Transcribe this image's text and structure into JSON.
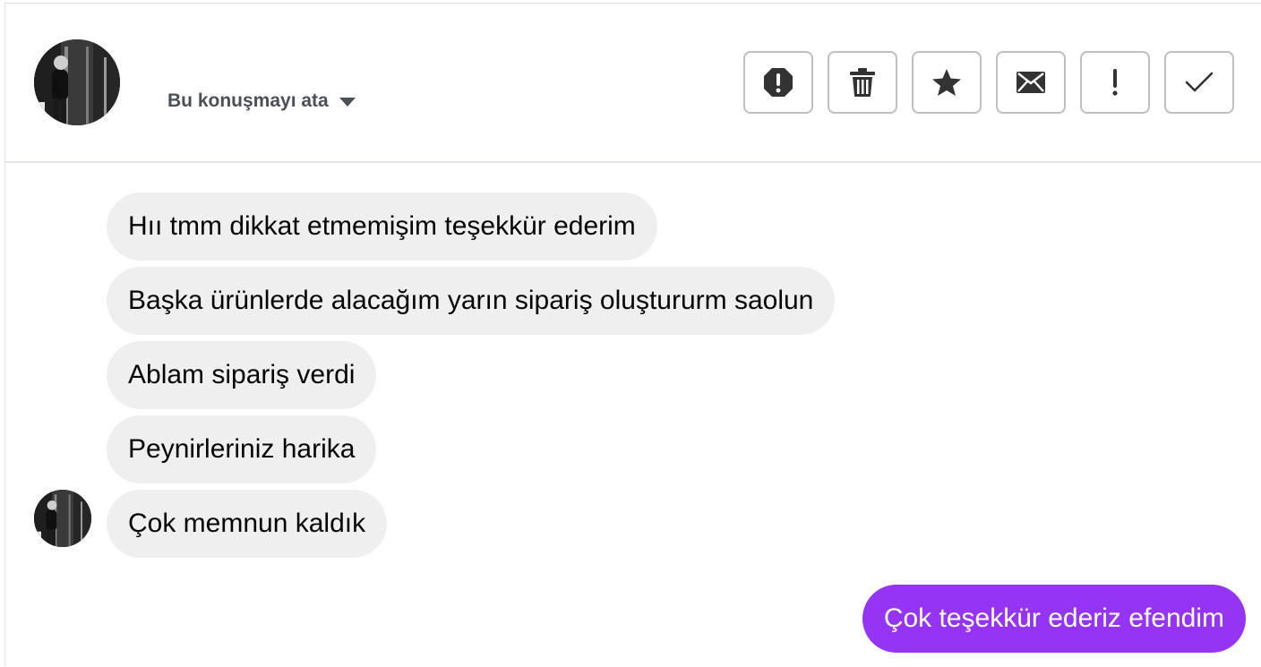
{
  "header": {
    "assign_label": "Bu konuşmayı ata",
    "actions": [
      {
        "icon": "alert-octagon-icon"
      },
      {
        "icon": "trash-icon"
      },
      {
        "icon": "star-icon"
      },
      {
        "icon": "envelope-icon"
      },
      {
        "icon": "exclamation-icon"
      },
      {
        "icon": "checkmark-icon"
      }
    ]
  },
  "messages": {
    "incoming": [
      "Hıı tmm dikkat etmemişim teşekkür ederim",
      "Başka ürünlerde alacağım yarın sipariş oluştururm saolun",
      "Ablam sipariş verdi",
      "Peynirleriniz harika",
      "Çok memnun kaldık"
    ],
    "outgoing": [
      "Çok teşekkür ederiz efendim"
    ]
  },
  "colors": {
    "incoming_bubble": "#efefef",
    "outgoing_bubble": "#9534f5",
    "icon": "#333333"
  }
}
